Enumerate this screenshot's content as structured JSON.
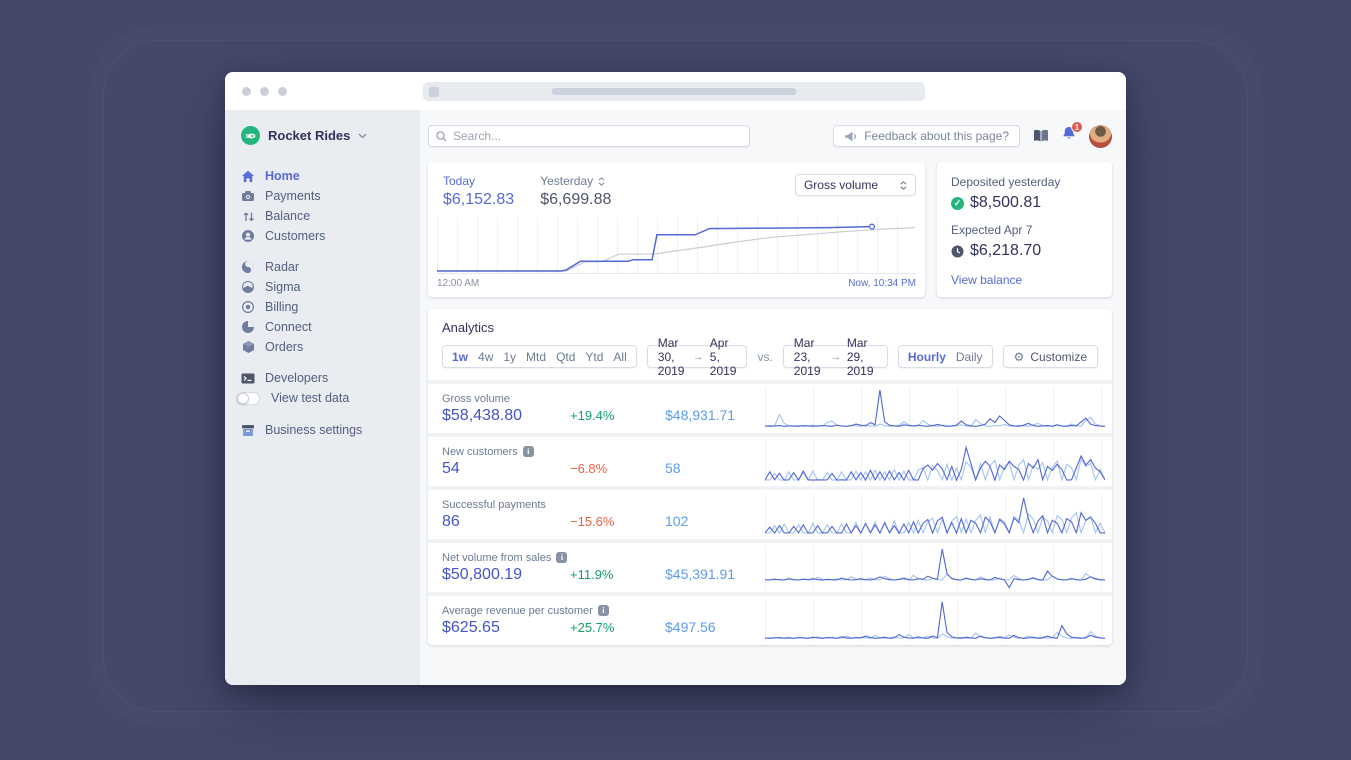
{
  "colors": {
    "desktop_bg": "#444869",
    "accent_blue": "#556cd6",
    "metric_indigo": "#4354c9",
    "positive_green": "#17a06a",
    "negative_red": "#ed5f42",
    "compare_blue": "#5d9cec",
    "brand_green": "#24b47e",
    "badge_red": "#e25950"
  },
  "sidebar": {
    "account_name": "Rocket Rides",
    "items": [
      {
        "label": "Home"
      },
      {
        "label": "Payments"
      },
      {
        "label": "Balance"
      },
      {
        "label": "Customers"
      },
      {
        "label": "Radar"
      },
      {
        "label": "Sigma"
      },
      {
        "label": "Billing"
      },
      {
        "label": "Connect"
      },
      {
        "label": "Orders"
      },
      {
        "label": "Developers"
      },
      {
        "label": "View test data"
      },
      {
        "label": "Business settings"
      }
    ]
  },
  "topbar": {
    "search_placeholder": "Search...",
    "feedback_label": "Feedback about this page?",
    "notification_count": "1"
  },
  "overview": {
    "today_label": "Today",
    "today_value": "$6,152.83",
    "yesterday_label": "Yesterday",
    "yesterday_value": "$6,699.88",
    "metric_select_value": "Gross volume",
    "x_start_label": "12:00 AM",
    "x_end_label": "Now, 10:34 PM"
  },
  "deposits": {
    "deposited_label": "Deposited yesterday",
    "deposited_value": "$8,500.81",
    "expected_label": "Expected Apr 7",
    "expected_value": "$6,218.70",
    "link_label": "View balance"
  },
  "analytics": {
    "title": "Analytics",
    "ranges": [
      "1w",
      "4w",
      "1y",
      "Mtd",
      "Qtd",
      "Ytd",
      "All"
    ],
    "active_range": "1w",
    "period_a": {
      "start": "Mar 30, 2019",
      "arrow": "→",
      "end": "Apr 5, 2019"
    },
    "vs_label": "vs.",
    "period_b": {
      "start": "Mar 23, 2019",
      "arrow": "→",
      "end": "Mar 29, 2019"
    },
    "granularity": {
      "options": [
        "Hourly",
        "Daily"
      ],
      "active": "Hourly"
    },
    "customize_label": "Customize",
    "metrics": [
      {
        "label": "Gross volume",
        "value": "$58,438.80",
        "change": "+19.4%",
        "change_dir": "up",
        "compare": "$48,931.71"
      },
      {
        "label": "New customers",
        "value": "54",
        "change": "−6.8%",
        "change_dir": "down",
        "compare": "58"
      },
      {
        "label": "Successful payments",
        "value": "86",
        "change": "−15.6%",
        "change_dir": "down",
        "compare": "102"
      },
      {
        "label": "Net volume from sales",
        "value": "$50,800.19",
        "change": "+11.9%",
        "change_dir": "up",
        "compare": "$45,391.91"
      },
      {
        "label": "Average revenue per customer",
        "value": "$625.65",
        "change": "+25.7%",
        "change_dir": "up",
        "compare": "$497.56"
      }
    ]
  },
  "chart_data": {
    "overview": {
      "type": "line",
      "title": "Gross volume today vs yesterday",
      "x_range": [
        "12:00 AM",
        "Now, 10:34 PM"
      ],
      "series_names": [
        "Today",
        "Yesterday"
      ],
      "today_value": 6152.83,
      "yesterday_value": 6699.88,
      "today": [
        [
          0,
          2
        ],
        [
          26,
          2
        ],
        [
          27,
          4
        ],
        [
          30,
          21
        ],
        [
          40,
          21
        ],
        [
          41,
          24
        ],
        [
          45,
          24
        ],
        [
          46,
          73
        ],
        [
          54,
          73
        ],
        [
          57,
          85
        ],
        [
          70,
          86
        ],
        [
          82,
          87
        ],
        [
          91,
          89
        ]
      ],
      "yesterday": [
        [
          0,
          2
        ],
        [
          27,
          2
        ],
        [
          31,
          20
        ],
        [
          34,
          20
        ],
        [
          35,
          22
        ],
        [
          38,
          35
        ],
        [
          43,
          35
        ],
        [
          46,
          36
        ],
        [
          55,
          48
        ],
        [
          62,
          58
        ],
        [
          70,
          68
        ],
        [
          78,
          74
        ],
        [
          85,
          79
        ],
        [
          93,
          84
        ],
        [
          100,
          87
        ]
      ]
    },
    "sparklines": [
      {
        "name": "Gross volume",
        "type": "line",
        "baseline": 0.93,
        "current": [
          3,
          2,
          3,
          4,
          2,
          3,
          3,
          2,
          4,
          3,
          2,
          3,
          4,
          3,
          2,
          5,
          3,
          2,
          4,
          8,
          5,
          3,
          12,
          6,
          100,
          14,
          5,
          3,
          2,
          6,
          4,
          3,
          5,
          3,
          2,
          4,
          7,
          4,
          2,
          3,
          5,
          16,
          6,
          3,
          2,
          4,
          8,
          22,
          12,
          30,
          18,
          6,
          3,
          2,
          5,
          10,
          4,
          2,
          3,
          4,
          2,
          6,
          3,
          2,
          4,
          3,
          14,
          24,
          8,
          4,
          3,
          2
        ],
        "prev": [
          2,
          4,
          3,
          34,
          10,
          3,
          2,
          4,
          2,
          3,
          5,
          2,
          3,
          12,
          16,
          5,
          3,
          2,
          4,
          3,
          2,
          6,
          3,
          2,
          8,
          4,
          2,
          3,
          5,
          14,
          6,
          2,
          3,
          18,
          8,
          3,
          2,
          5,
          3,
          2,
          4,
          6,
          3,
          2,
          20,
          9,
          3,
          2,
          4,
          3,
          7,
          3,
          2,
          5,
          3,
          2,
          6,
          10,
          4,
          2,
          3,
          6,
          2,
          3,
          8,
          4,
          2,
          18,
          26,
          9,
          3,
          2
        ]
      },
      {
        "name": "New customers",
        "type": "line",
        "baseline": 0.95,
        "current": [
          2,
          24,
          3,
          20,
          2,
          3,
          22,
          2,
          26,
          3,
          2,
          3,
          2,
          3,
          20,
          2,
          3,
          2,
          24,
          3,
          22,
          2,
          28,
          3,
          24,
          2,
          26,
          3,
          22,
          2,
          28,
          3,
          2,
          32,
          42,
          28,
          46,
          32,
          3,
          38,
          2,
          30,
          88,
          46,
          3,
          34,
          52,
          38,
          2,
          42,
          30,
          52,
          38,
          30,
          2,
          46,
          34,
          56,
          3,
          38,
          28,
          44,
          30,
          2,
          3,
          34,
          66,
          42,
          56,
          34,
          24,
          3
        ],
        "prev": [
          3,
          2,
          20,
          3,
          2,
          24,
          2,
          3,
          22,
          2,
          26,
          2,
          3,
          22,
          2,
          3,
          24,
          2,
          3,
          26,
          2,
          24,
          3,
          28,
          2,
          24,
          3,
          30,
          2,
          26,
          3,
          2,
          28,
          36,
          2,
          40,
          28,
          3,
          44,
          2,
          34,
          3,
          50,
          36,
          2,
          46,
          3,
          40,
          54,
          3,
          36,
          48,
          3,
          42,
          56,
          3,
          40,
          30,
          48,
          3,
          36,
          52,
          3,
          44,
          34,
          3,
          58,
          38,
          46,
          3,
          30,
          2
        ]
      },
      {
        "name": "Successful payments",
        "type": "line",
        "baseline": 0.95,
        "current": [
          3,
          18,
          2,
          22,
          3,
          2,
          20,
          3,
          24,
          2,
          3,
          22,
          2,
          3,
          20,
          3,
          2,
          26,
          3,
          22,
          2,
          28,
          3,
          24,
          2,
          30,
          3,
          22,
          2,
          26,
          3,
          32,
          2,
          28,
          38,
          2,
          34,
          44,
          3,
          30,
          2,
          40,
          3,
          36,
          28,
          3,
          44,
          32,
          3,
          38,
          26,
          3,
          42,
          30,
          95,
          40,
          3,
          34,
          48,
          3,
          36,
          28,
          3,
          40,
          32,
          3,
          56,
          36,
          44,
          28,
          3,
          2
        ],
        "prev": [
          2,
          3,
          22,
          2,
          26,
          3,
          2,
          24,
          3,
          2,
          28,
          2,
          3,
          24,
          3,
          2,
          26,
          3,
          2,
          30,
          2,
          26,
          3,
          32,
          2,
          28,
          3,
          34,
          2,
          3,
          30,
          2,
          36,
          3,
          32,
          42,
          3,
          38,
          2,
          34,
          46,
          3,
          40,
          3,
          36,
          50,
          3,
          44,
          3,
          40,
          32,
          3,
          46,
          36,
          3,
          52,
          40,
          3,
          44,
          34,
          3,
          48,
          38,
          3,
          42,
          56,
          3,
          36,
          46,
          3,
          28,
          3
        ]
      },
      {
        "name": "Net volume from sales",
        "type": "line",
        "baseline": 0.8,
        "current": [
          3,
          2,
          4,
          3,
          2,
          5,
          3,
          2,
          4,
          3,
          6,
          3,
          2,
          4,
          3,
          2,
          8,
          4,
          2,
          3,
          6,
          3,
          2,
          5,
          12,
          6,
          3,
          2,
          4,
          8,
          3,
          2,
          6,
          4,
          14,
          8,
          4,
          100,
          22,
          6,
          3,
          2,
          8,
          4,
          2,
          6,
          3,
          2,
          10,
          5,
          3,
          -22,
          6,
          3,
          2,
          4,
          8,
          3,
          2,
          30,
          14,
          5,
          3,
          2,
          6,
          3,
          2,
          4,
          12,
          6,
          3,
          2
        ],
        "prev": [
          2,
          3,
          5,
          2,
          3,
          8,
          3,
          2,
          5,
          3,
          2,
          10,
          4,
          2,
          3,
          6,
          2,
          3,
          12,
          5,
          2,
          3,
          8,
          3,
          2,
          14,
          6,
          2,
          3,
          5,
          2,
          16,
          7,
          3,
          2,
          6,
          3,
          2,
          20,
          8,
          3,
          2,
          6,
          3,
          2,
          12,
          5,
          2,
          3,
          8,
          2,
          3,
          16,
          6,
          2,
          3,
          10,
          4,
          2,
          3,
          14,
          5,
          2,
          3,
          8,
          3,
          2,
          22,
          10,
          4,
          2,
          3
        ]
      },
      {
        "name": "Average revenue per customer",
        "type": "line",
        "baseline": 0.93,
        "current": [
          3,
          2,
          3,
          4,
          2,
          3,
          2,
          4,
          3,
          2,
          5,
          3,
          2,
          4,
          3,
          2,
          6,
          3,
          2,
          4,
          3,
          8,
          4,
          2,
          3,
          5,
          2,
          3,
          12,
          5,
          3,
          2,
          6,
          3,
          2,
          8,
          4,
          100,
          18,
          6,
          3,
          2,
          5,
          3,
          2,
          8,
          4,
          2,
          3,
          6,
          3,
          2,
          10,
          4,
          2,
          3,
          5,
          2,
          3,
          8,
          4,
          2,
          36,
          14,
          5,
          3,
          2,
          4,
          10,
          5,
          3,
          2
        ],
        "prev": [
          2,
          3,
          4,
          2,
          3,
          5,
          2,
          3,
          4,
          2,
          3,
          6,
          2,
          3,
          5,
          2,
          3,
          8,
          3,
          2,
          5,
          3,
          2,
          10,
          4,
          2,
          3,
          6,
          2,
          3,
          12,
          4,
          2,
          3,
          8,
          3,
          2,
          14,
          6,
          2,
          3,
          5,
          2,
          3,
          16,
          6,
          3,
          2,
          5,
          3,
          2,
          12,
          5,
          2,
          3,
          8,
          2,
          3,
          6,
          2,
          3,
          18,
          8,
          3,
          2,
          5,
          3,
          2,
          20,
          8,
          3,
          2
        ]
      }
    ]
  }
}
